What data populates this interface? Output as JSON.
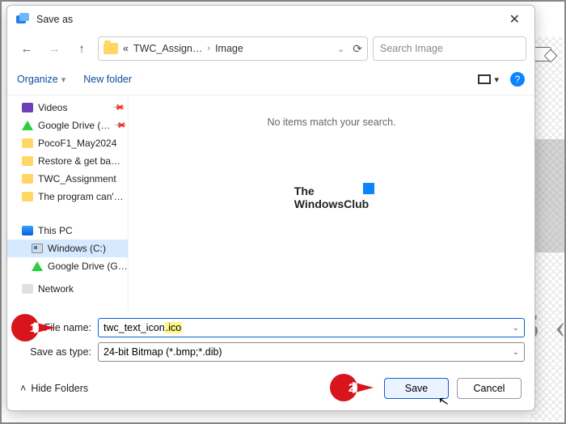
{
  "dialog": {
    "title": "Save as",
    "close_aria": "Close"
  },
  "nav": {
    "path_prefix": "«",
    "crumb1": "TWC_Assign…",
    "crumb2": "Image",
    "refresh_aria": "Refresh",
    "search_placeholder": "Search Image"
  },
  "toolbar": {
    "organize": "Organize",
    "new_folder": "New folder",
    "help_aria": "Help"
  },
  "tree": {
    "items": [
      {
        "icon": "video",
        "label": "Videos",
        "pinned": true
      },
      {
        "icon": "gdrive",
        "label": "Google Drive (…",
        "pinned": true
      },
      {
        "icon": "folder",
        "label": "PocoF1_May2024",
        "pinned": false
      },
      {
        "icon": "folder",
        "label": "Restore & get ba…",
        "pinned": false
      },
      {
        "icon": "folder",
        "label": "TWC_Assignment",
        "pinned": false
      },
      {
        "icon": "folder",
        "label": "The program can'…",
        "pinned": false
      }
    ],
    "pc_label": "This PC",
    "drive_label": "Windows (C:)",
    "gdrive2_label": "Google Drive (G…",
    "network_label": "Network"
  },
  "content": {
    "empty": "No items match your search.",
    "watermark_line1": "The",
    "watermark_line2": "WindowsClub"
  },
  "fields": {
    "filename_label": "File name:",
    "filename_value_prefix": "twc_text_icon",
    "filename_value_ext": ".ico",
    "type_label": "Save as type:",
    "type_value": "24-bit Bitmap (*.bmp;*.dib)"
  },
  "footer": {
    "hide_folders": "Hide Folders",
    "save": "Save",
    "cancel": "Cancel"
  },
  "callouts": {
    "one": "1",
    "two": "2"
  },
  "bg_glyph": "S ‹"
}
